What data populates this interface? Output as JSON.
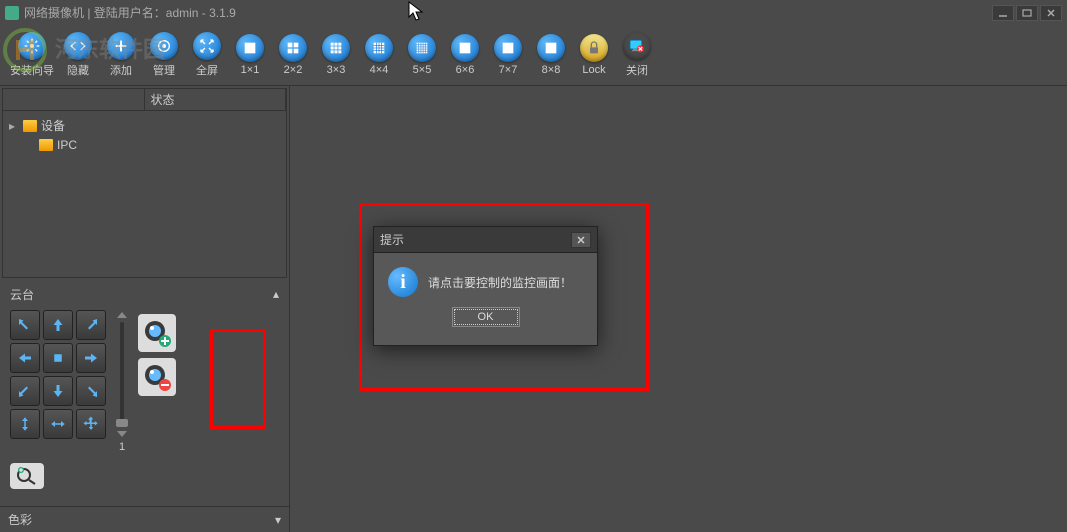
{
  "titlebar": {
    "title": "网络摄像机 | 登陆用户名：admin - 3.1.9"
  },
  "toolbar": {
    "items": [
      {
        "label": "安装向导",
        "icon": "gear"
      },
      {
        "label": "隐藏",
        "icon": "hide"
      },
      {
        "label": "添加",
        "icon": "add"
      },
      {
        "label": "管理",
        "icon": "manage"
      },
      {
        "label": "全屏",
        "icon": "fullscreen"
      },
      {
        "label": "1×1",
        "icon": "grid1"
      },
      {
        "label": "2×2",
        "icon": "grid2"
      },
      {
        "label": "3×3",
        "icon": "grid3"
      },
      {
        "label": "4×4",
        "icon": "grid4"
      },
      {
        "label": "5×5",
        "icon": "grid5"
      },
      {
        "label": "6×6",
        "icon": "grid6"
      },
      {
        "label": "7×7",
        "icon": "grid7"
      },
      {
        "label": "8×8",
        "icon": "grid8"
      },
      {
        "label": "Lock",
        "icon": "lock"
      },
      {
        "label": "关闭",
        "icon": "close"
      }
    ]
  },
  "tree": {
    "colStatus": "状态",
    "rootLabel": "设备",
    "childLabel": "IPC"
  },
  "ptz": {
    "title": "云台",
    "sliderValue": "1"
  },
  "color": {
    "title": "色彩"
  },
  "dialog": {
    "title": "提示",
    "message": "请点击要控制的监控画面！",
    "ok": "OK"
  }
}
